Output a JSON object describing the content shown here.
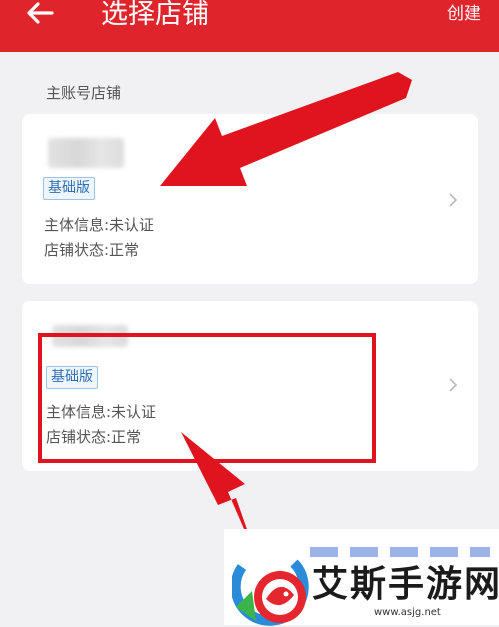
{
  "header": {
    "title": "选择店铺",
    "create_label": "创建",
    "background": "#e0242b",
    "back_icon": "arrow-left-icon"
  },
  "section": {
    "label": "主账号店铺"
  },
  "stores": [
    {
      "badge": "基础版",
      "subject_info": "主体信息:未认证",
      "status": "店铺状态:正常"
    },
    {
      "badge": "基础版",
      "subject_info": "主体信息:未认证",
      "status": "店铺状态:正常"
    }
  ],
  "watermark": {
    "text": "艾斯手游网",
    "url": "www.asjg.net"
  },
  "colors": {
    "accent_red": "#e0141f",
    "badge_blue": "#2f6fb4",
    "page_bg": "#f1f1f3"
  }
}
